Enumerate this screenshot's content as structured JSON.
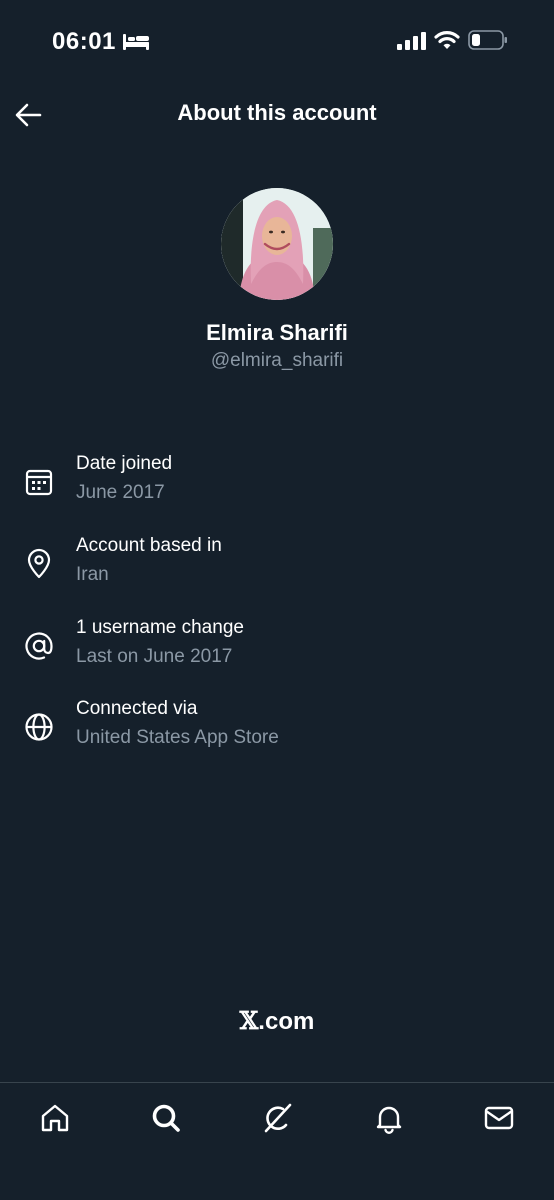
{
  "status_bar": {
    "time": "06:01",
    "icons": [
      "bed-icon",
      "signal-icon",
      "wifi-icon",
      "battery-icon"
    ]
  },
  "header": {
    "title": "About this account",
    "back_icon": "arrow-left-icon"
  },
  "profile": {
    "name": "Elmira Sharifi",
    "handle": "@elmira_sharifi"
  },
  "details": [
    {
      "icon": "calendar-icon",
      "title": "Date joined",
      "value": "June 2017"
    },
    {
      "icon": "location-pin-icon",
      "title": "Account based in",
      "value": "Iran"
    },
    {
      "icon": "at-sign-icon",
      "title": "1 username change",
      "value": "Last on June 2017"
    },
    {
      "icon": "globe-icon",
      "title": "Connected via",
      "value": "United States App Store"
    }
  ],
  "footer": {
    "x_glyph": "𝕏",
    "domain": ".com"
  },
  "tab_bar": {
    "tabs": [
      "home-icon",
      "search-icon",
      "grok-icon",
      "notifications-bell-icon",
      "messages-envelope-icon"
    ]
  },
  "colors": {
    "background": "#15202b",
    "text_primary": "#ffffff",
    "text_secondary": "#8b98a5",
    "divider": "#38444d"
  }
}
